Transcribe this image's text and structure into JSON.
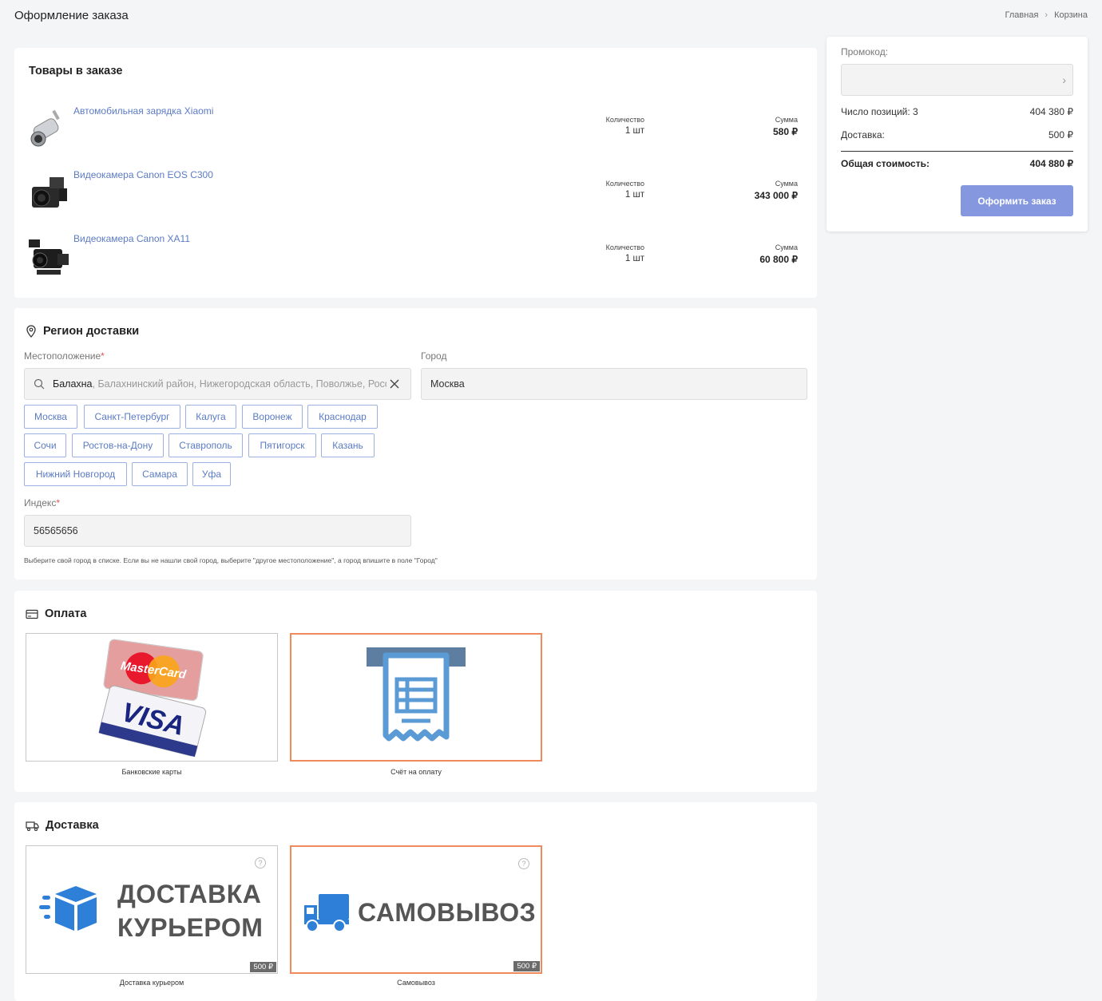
{
  "page": {
    "title": "Оформление заказа"
  },
  "breadcrumb": {
    "home": "Главная",
    "current": "Корзина"
  },
  "order": {
    "title": "Товары в заказе",
    "qty_label": "Количество",
    "sum_label": "Сумма",
    "items": [
      {
        "name": "Автомобильная зарядка Xiaomi",
        "qty": "1 шт",
        "sum": "580 ₽",
        "icon": "car-charger-image"
      },
      {
        "name": "Видеокамера Canon EOS C300",
        "qty": "1 шт",
        "sum": "343 000 ₽",
        "icon": "camcorder-image"
      },
      {
        "name": "Видеокамера Canon XA11",
        "qty": "1 шт",
        "sum": "60 800 ₽",
        "icon": "camcorder-image"
      }
    ]
  },
  "region": {
    "title": "Регион доставки",
    "location_label": "Местоположение",
    "location_value": "Балахна",
    "location_rest": ", Балахнинский район, Нижегородская область, Поволжье, Росси",
    "city_label": "Город",
    "city_value": "Москва",
    "cities": [
      "Москва",
      "Санкт-Петербург",
      "Калуга",
      "Воронеж",
      "Краснодар",
      "Сочи",
      "Ростов-на-Дону",
      "Ставрополь",
      "Пятигорск",
      "Казань",
      "Нижний Новгород",
      "Самара",
      "Уфа"
    ],
    "index_label": "Индекс",
    "index_value": "56565656",
    "required_mark": "*",
    "hint": "Выберите свой город в списке. Если вы не нашли свой город, выберите \"другое местоположение\", а город впишите в поле \"Город\""
  },
  "payment": {
    "title": "Оплата",
    "options": [
      {
        "caption": "Банковские карты",
        "mastercard": "MasterCard",
        "visa": "VISA"
      },
      {
        "caption": "Счёт на оплату"
      }
    ]
  },
  "delivery": {
    "title": "Доставка",
    "help": "?",
    "options": [
      {
        "caption": "Доставка курьером",
        "line1": "ДОСТАВКА",
        "line2": "КУРЬЕРОМ",
        "price": "500 ₽"
      },
      {
        "caption": "Самовывоз",
        "line1": "САМОВЫВОЗ",
        "price": "500 ₽"
      }
    ]
  },
  "summary": {
    "promo_label": "Промокод:",
    "promo_value": "",
    "positions_label": "Число позиций: 3",
    "positions_value": "404 380 ₽",
    "delivery_label": "Доставка:",
    "delivery_value": "500 ₽",
    "total_label": "Общая стоимость:",
    "total_value": "404 880 ₽",
    "submit": "Оформить заказ"
  },
  "colors": {
    "accent": "#5b7bc4",
    "button": "#8497df",
    "active_border": "#f08a5d"
  }
}
